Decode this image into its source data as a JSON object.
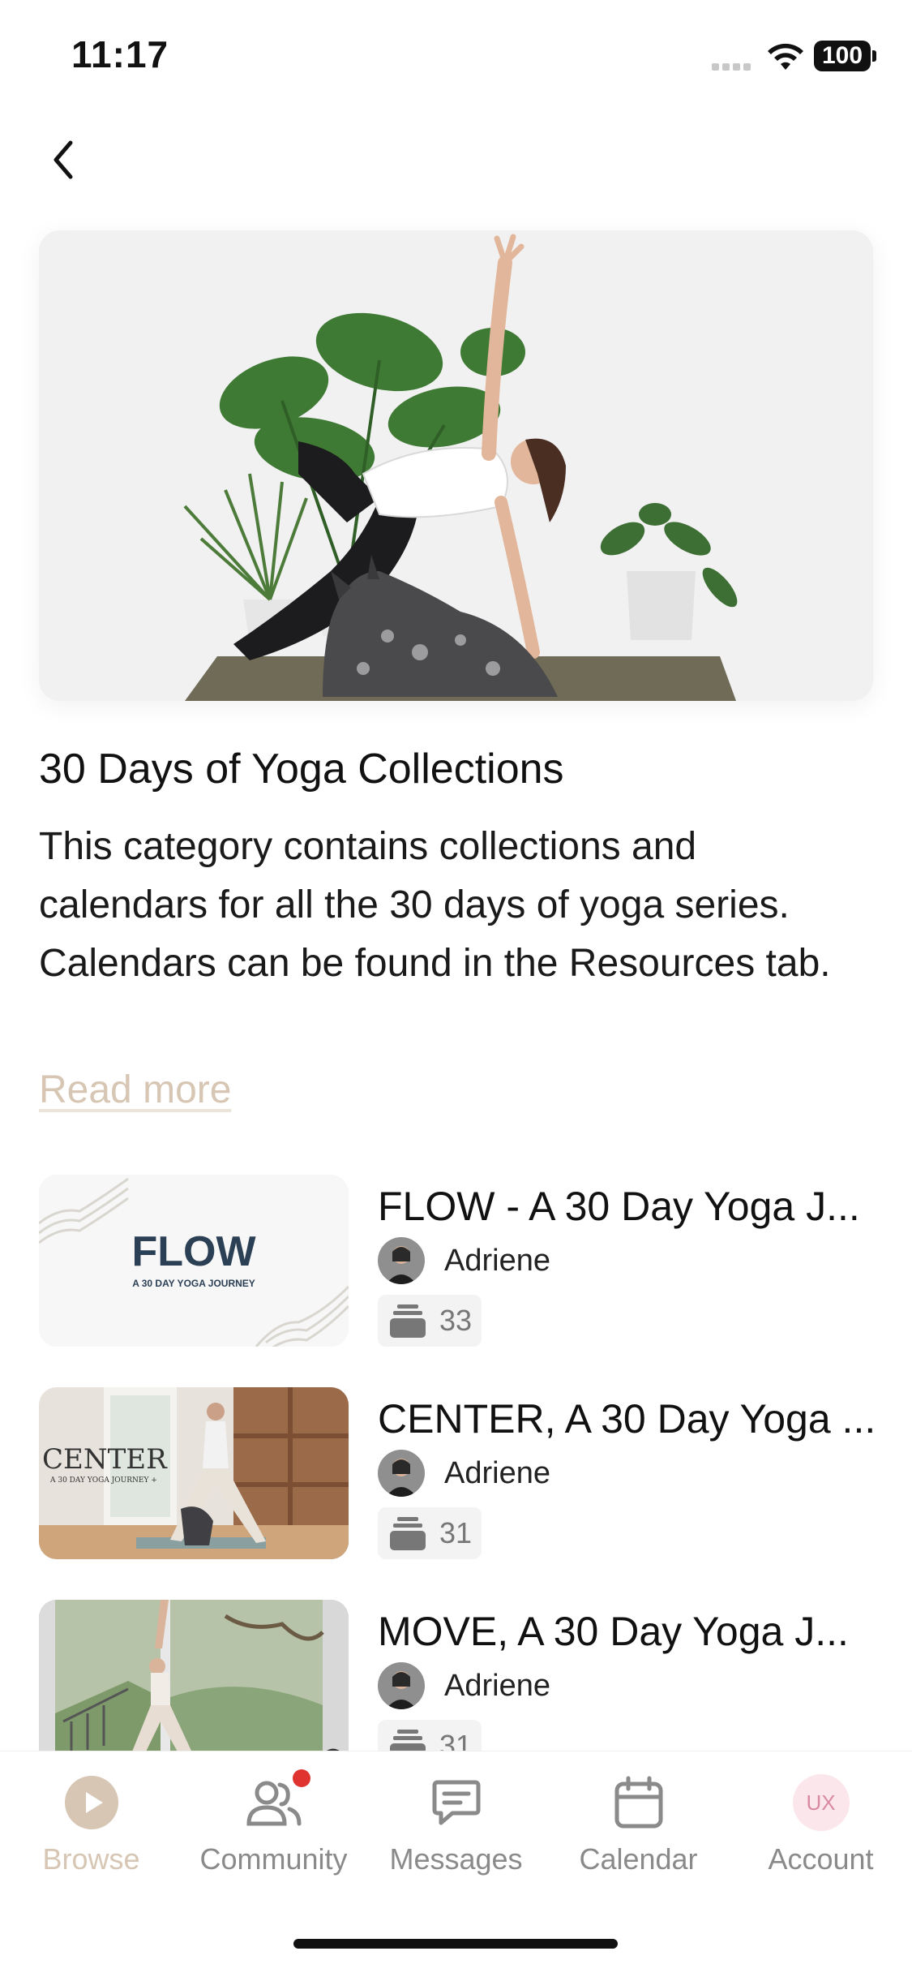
{
  "status_bar": {
    "time": "11:17",
    "battery": "100"
  },
  "hero": {
    "image": "yoga-side-plank-with-dog-photo"
  },
  "category": {
    "title": "30 Days of Yoga Collections",
    "description": "This category contains collections and calendars for all the 30 days of yoga series. Calendars can be found in the Resources tab.",
    "read_more": "Read more"
  },
  "collections": [
    {
      "title": "FLOW - A 30 Day Yoga J...",
      "author": "Adriene",
      "count": "33",
      "thumb_title": "FLOW",
      "thumb_subtitle": "A 30 DAY YOGA JOURNEY"
    },
    {
      "title": "CENTER, A 30 Day Yoga ...",
      "author": "Adriene",
      "count": "31",
      "thumb_title": "CENTER",
      "thumb_subtitle": "A 30 DAY YOGA JOURNEY +"
    },
    {
      "title": "MOVE, A 30 Day Yoga J...",
      "author": "Adriene",
      "count": "31"
    }
  ],
  "tab_bar": {
    "tabs": [
      {
        "label": "Browse",
        "icon": "play-icon",
        "active": true
      },
      {
        "label": "Community",
        "icon": "users-icon",
        "has_notification": true
      },
      {
        "label": "Messages",
        "icon": "message-icon"
      },
      {
        "label": "Calendar",
        "icon": "calendar-icon"
      },
      {
        "label": "Account",
        "icon": "avatar-initials",
        "initials": "UX"
      }
    ]
  },
  "colors": {
    "accent": "#d6c6b3",
    "inactive": "#8a8a8a",
    "notification": "#e0322f"
  }
}
